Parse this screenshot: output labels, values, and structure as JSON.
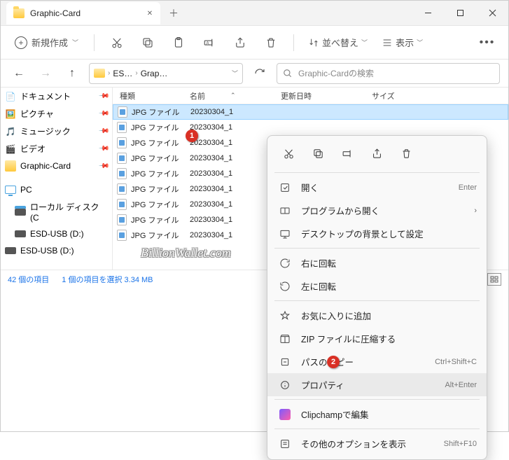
{
  "titlebar": {
    "tab_title": "Graphic-Card"
  },
  "toolbar": {
    "new_label": "新規作成",
    "sort_label": "並べ替え",
    "view_label": "表示"
  },
  "nav": {
    "breadcrumb": {
      "seg1": "ES…",
      "seg2": "Grap…"
    },
    "search_placeholder": "Graphic-Cardの検索"
  },
  "sidebar": {
    "items": [
      {
        "label": "ドキュメント",
        "pinned": true
      },
      {
        "label": "ピクチャ",
        "pinned": true
      },
      {
        "label": "ミュージック",
        "pinned": true
      },
      {
        "label": "ビデオ",
        "pinned": true
      },
      {
        "label": "Graphic-Card",
        "pinned": true
      }
    ],
    "pc_label": "PC",
    "drives": [
      {
        "label": "ローカル ディスク (C"
      },
      {
        "label": "ESD-USB (D:)"
      },
      {
        "label": "ESD-USB (D:)"
      }
    ]
  },
  "columns": {
    "type": "種類",
    "name": "名前",
    "date": "更新日時",
    "size": "サイズ"
  },
  "files": {
    "type_label": "JPG ファイル",
    "rows": [
      {
        "name": "20230304_1"
      },
      {
        "name": "20230304_1"
      },
      {
        "name": "20230304_1"
      },
      {
        "name": "20230304_1"
      },
      {
        "name": "20230304_1"
      },
      {
        "name": "20230304_1"
      },
      {
        "name": "20230304_1"
      },
      {
        "name": "20230304_1"
      },
      {
        "name": "20230304_1"
      }
    ]
  },
  "status": {
    "count": "42 個の項目",
    "selection": "1 個の項目を選択 3.34 MB"
  },
  "context_menu": {
    "open": "開く",
    "open_hint": "Enter",
    "open_with": "プログラムから開く",
    "set_bg": "デスクトップの背景として設定",
    "rotate_r": "右に回転",
    "rotate_l": "左に回転",
    "fav": "お気に入りに追加",
    "zip": "ZIP ファイルに圧縮する",
    "copy_path": "パスのコピー",
    "copy_path_hint": "Ctrl+Shift+C",
    "props": "プロパティ",
    "props_hint": "Alt+Enter",
    "clipchamp": "Clipchampで編集",
    "more": "その他のオプションを表示",
    "more_hint": "Shift+F10"
  },
  "badges": {
    "b1": "1",
    "b2": "2"
  },
  "watermark": "BillionWallet.com"
}
